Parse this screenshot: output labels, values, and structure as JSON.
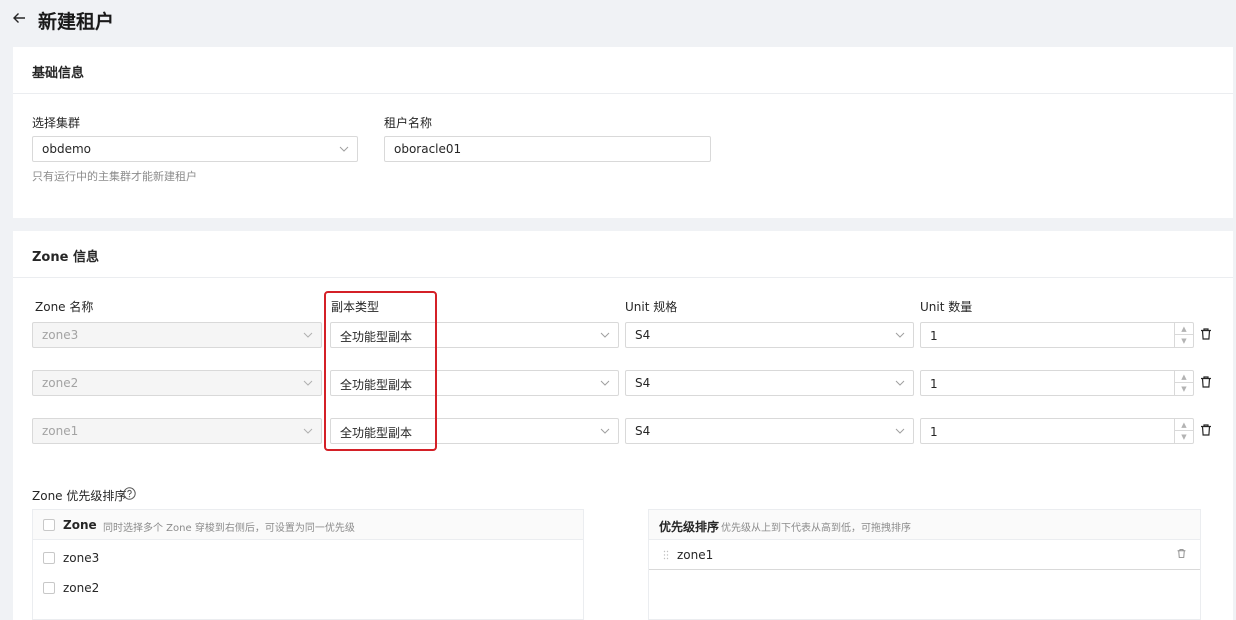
{
  "header": {
    "title": "新建租户"
  },
  "basic": {
    "title": "基础信息",
    "cluster_label": "选择集群",
    "cluster_value": "obdemo",
    "cluster_hint": "只有运行中的主集群才能新建租户",
    "tenant_label": "租户名称",
    "tenant_value": "oboracle01"
  },
  "zone": {
    "title": "Zone 信息",
    "columns": {
      "name": "Zone 名称",
      "replica": "副本类型",
      "unit_spec": "Unit 规格",
      "unit_count": "Unit 数量"
    },
    "rows": [
      {
        "zone": "zone3",
        "replica": "全功能型副本",
        "unit": "S4",
        "count": "1"
      },
      {
        "zone": "zone2",
        "replica": "全功能型副本",
        "unit": "S4",
        "count": "1"
      },
      {
        "zone": "zone1",
        "replica": "全功能型副本",
        "unit": "S4",
        "count": "1"
      }
    ],
    "priority": {
      "title": "Zone 优先级排序",
      "left_header": "Zone",
      "left_hint": "同时选择多个 Zone 穿梭到右侧后，可设置为同一优先级",
      "left_items": [
        "zone3",
        "zone2"
      ],
      "right_header": "优先级排序",
      "right_hint": "优先级从上到下代表从高到低，可拖拽排序",
      "right_items": [
        "zone1"
      ]
    }
  },
  "colors": {
    "highlight": "#d42027",
    "disabled_bg": "#f5f5f5"
  }
}
